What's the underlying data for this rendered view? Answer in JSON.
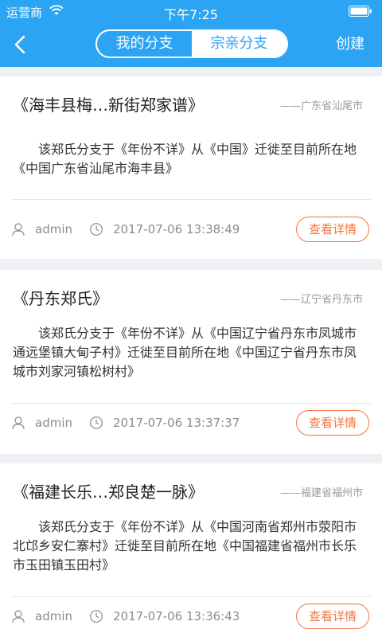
{
  "status_bar": {
    "carrier": "运营商",
    "time": "下午7:25"
  },
  "nav": {
    "tabs": [
      {
        "label": "我的分支",
        "active": false
      },
      {
        "label": "宗亲分支",
        "active": true
      }
    ],
    "create_label": "创建"
  },
  "colors": {
    "primary": "#2ba4f4",
    "accent": "#f3743e"
  },
  "branches": [
    {
      "title": "《海丰县梅…新街郑家谱》",
      "region": "——广东省汕尾市",
      "description": "该郑氏分支于《年份不详》从《中国》迁徙至目前所在地《中国广东省汕尾市海丰县》",
      "user": "admin",
      "time": "2017-07-06 13:38:49",
      "button": "查看详情"
    },
    {
      "title": "《丹东郑氏》",
      "region": "——辽宁省丹东市",
      "description": "该郑氏分支于《年份不详》从《中国辽宁省丹东市凤城市通远堡镇大甸子村》迁徙至目前所在地《中国辽宁省丹东市凤城市刘家河镇松树村》",
      "user": "admin",
      "time": "2017-07-06 13:37:37",
      "button": "查看详情"
    },
    {
      "title": "《福建长乐…郑良楚一脉》",
      "region": "——福建省福州市",
      "description": "该郑氏分支于《年份不详》从《中国河南省郑州市荥阳市北邙乡安仁寨村》迁徙至目前所在地《中国福建省福州市长乐市玉田镇玉田村》",
      "user": "admin",
      "time": "2017-07-06 13:36:43",
      "button": "查看详情"
    }
  ]
}
